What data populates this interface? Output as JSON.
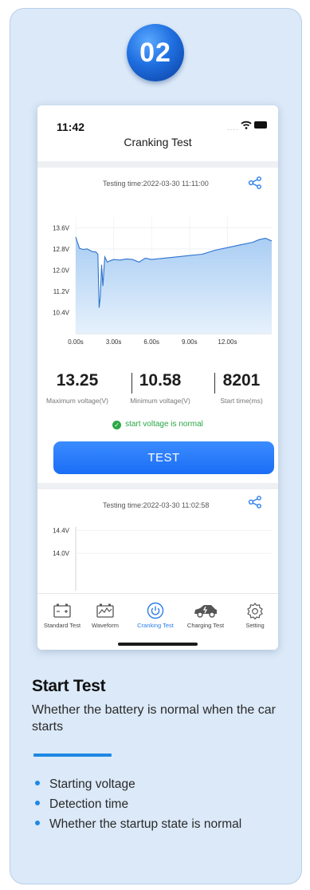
{
  "badge": {
    "number": "02"
  },
  "phone": {
    "status_time": "11:42",
    "title": "Cranking Test",
    "record1": {
      "testing_time": "Testing time:2022-03-30 11:11:00",
      "metrics": [
        {
          "value": "13.25",
          "label": "Maximum voltage(V)"
        },
        {
          "value": "10.58",
          "label": "Minimum voltage(V)"
        },
        {
          "value": "8201",
          "label": "Start time(ms)"
        }
      ],
      "status_text": "start voltage is normal",
      "status_color": "#2aa845"
    },
    "test_button": "TEST",
    "record2": {
      "testing_time": "Testing time:2022-03-30 11:02:58"
    },
    "tabs": [
      {
        "label": "Standard Test",
        "icon": "battery-icon",
        "active": false
      },
      {
        "label": "Waveform",
        "icon": "waveform-icon",
        "active": false
      },
      {
        "label": "Cranking Test",
        "icon": "power-icon",
        "active": true
      },
      {
        "label": "Charging Test",
        "icon": "car-charging-icon",
        "active": false
      },
      {
        "label": "Setting",
        "icon": "gear-icon",
        "active": false
      }
    ],
    "accent_color": "#2b7de9"
  },
  "chart_data": [
    {
      "type": "area",
      "title": "",
      "xlabel": "",
      "ylabel": "",
      "x_ticks": [
        "0.00s",
        "3.00s",
        "6.00s",
        "9.00s",
        "12.00s"
      ],
      "y_ticks": [
        "13.6V",
        "12.8V",
        "12.0V",
        "11.2V",
        "10.4V"
      ],
      "xlim": [
        0,
        15.5
      ],
      "ylim": [
        9.6,
        14.0
      ],
      "grid": true,
      "series": [
        {
          "x": [
            0,
            0.3,
            0.6,
            0.9,
            1.1,
            1.3,
            1.6,
            1.75,
            1.85,
            1.95,
            2.05,
            2.15,
            2.3,
            2.5,
            2.7,
            3.0,
            3.5,
            4.0,
            4.5,
            5.0,
            5.5,
            6.0,
            7.0,
            8.0,
            9.0,
            10.0,
            11.0,
            12.0,
            13.0,
            14.0,
            14.5,
            15.0,
            15.5
          ],
          "y": [
            13.25,
            12.82,
            12.78,
            12.8,
            12.75,
            12.7,
            12.68,
            12.6,
            10.58,
            11.0,
            12.2,
            11.4,
            12.5,
            12.3,
            12.35,
            12.4,
            12.38,
            12.42,
            12.4,
            12.3,
            12.45,
            12.4,
            12.45,
            12.5,
            12.55,
            12.6,
            12.75,
            12.85,
            12.95,
            13.05,
            13.15,
            13.2,
            13.1
          ]
        }
      ]
    },
    {
      "type": "line",
      "y_ticks": [
        "14.4V",
        "14.0V"
      ],
      "grid": true,
      "series": []
    }
  ],
  "section": {
    "title": "Start Test",
    "description": "Whether the battery is normal when the car starts",
    "bullets": [
      "Starting voltage",
      "Detection time",
      "Whether the startup state is normal"
    ],
    "accent_color": "#1e88e5"
  }
}
